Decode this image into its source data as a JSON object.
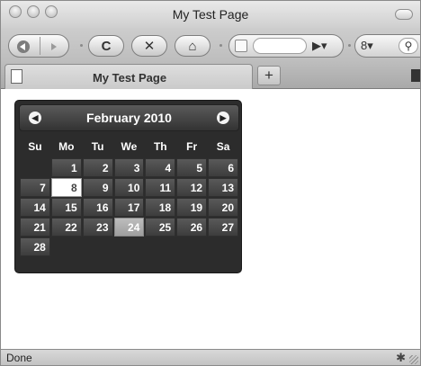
{
  "window": {
    "title": "My Test Page"
  },
  "toolbar": {
    "back_icon": "back-arrow-icon",
    "forward_icon": "forward-arrow-icon",
    "reload_glyph": "C",
    "stop_glyph": "✕",
    "home_glyph": "⌂",
    "go_glyph": "▶▾",
    "search_engine_glyph": "8▾",
    "search_glyph": "⚲"
  },
  "tabs": {
    "active_label": "My Test Page",
    "new_tab_label": "+"
  },
  "datepicker": {
    "prev_label": "◀",
    "next_label": "▶",
    "month_title": "February 2010",
    "weekdays": [
      "Su",
      "Mo",
      "Tu",
      "We",
      "Th",
      "Fr",
      "Sa"
    ],
    "weeks": [
      [
        "",
        "1",
        "2",
        "3",
        "4",
        "5",
        "6"
      ],
      [
        "7",
        "8",
        "9",
        "10",
        "11",
        "12",
        "13"
      ],
      [
        "14",
        "15",
        "16",
        "17",
        "18",
        "19",
        "20"
      ],
      [
        "21",
        "22",
        "23",
        "24",
        "25",
        "26",
        "27"
      ],
      [
        "28",
        "",
        "",
        "",
        "",
        "",
        ""
      ]
    ],
    "today": "8",
    "selected": "24"
  },
  "status": {
    "text": "Done"
  }
}
